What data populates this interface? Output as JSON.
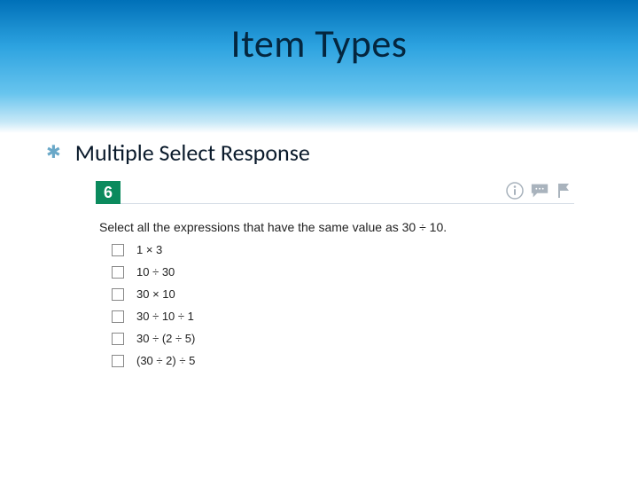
{
  "title": "Item Types",
  "bullet": "Multiple Select Response",
  "question": {
    "number": "6",
    "prompt_prefix": "Select all the expressions that have the same value as ",
    "prompt_expr": "30 ÷ 10",
    "prompt_suffix": ".",
    "options": [
      "1 × 3",
      "10 ÷ 30",
      "30 × 10",
      "30 ÷ 10 ÷ 1",
      "30 ÷ (2 ÷ 5)",
      "(30 ÷ 2) ÷ 5"
    ]
  },
  "colors": {
    "accent_green": "#0b8a5d",
    "icon_gray": "#a9b3bd"
  }
}
